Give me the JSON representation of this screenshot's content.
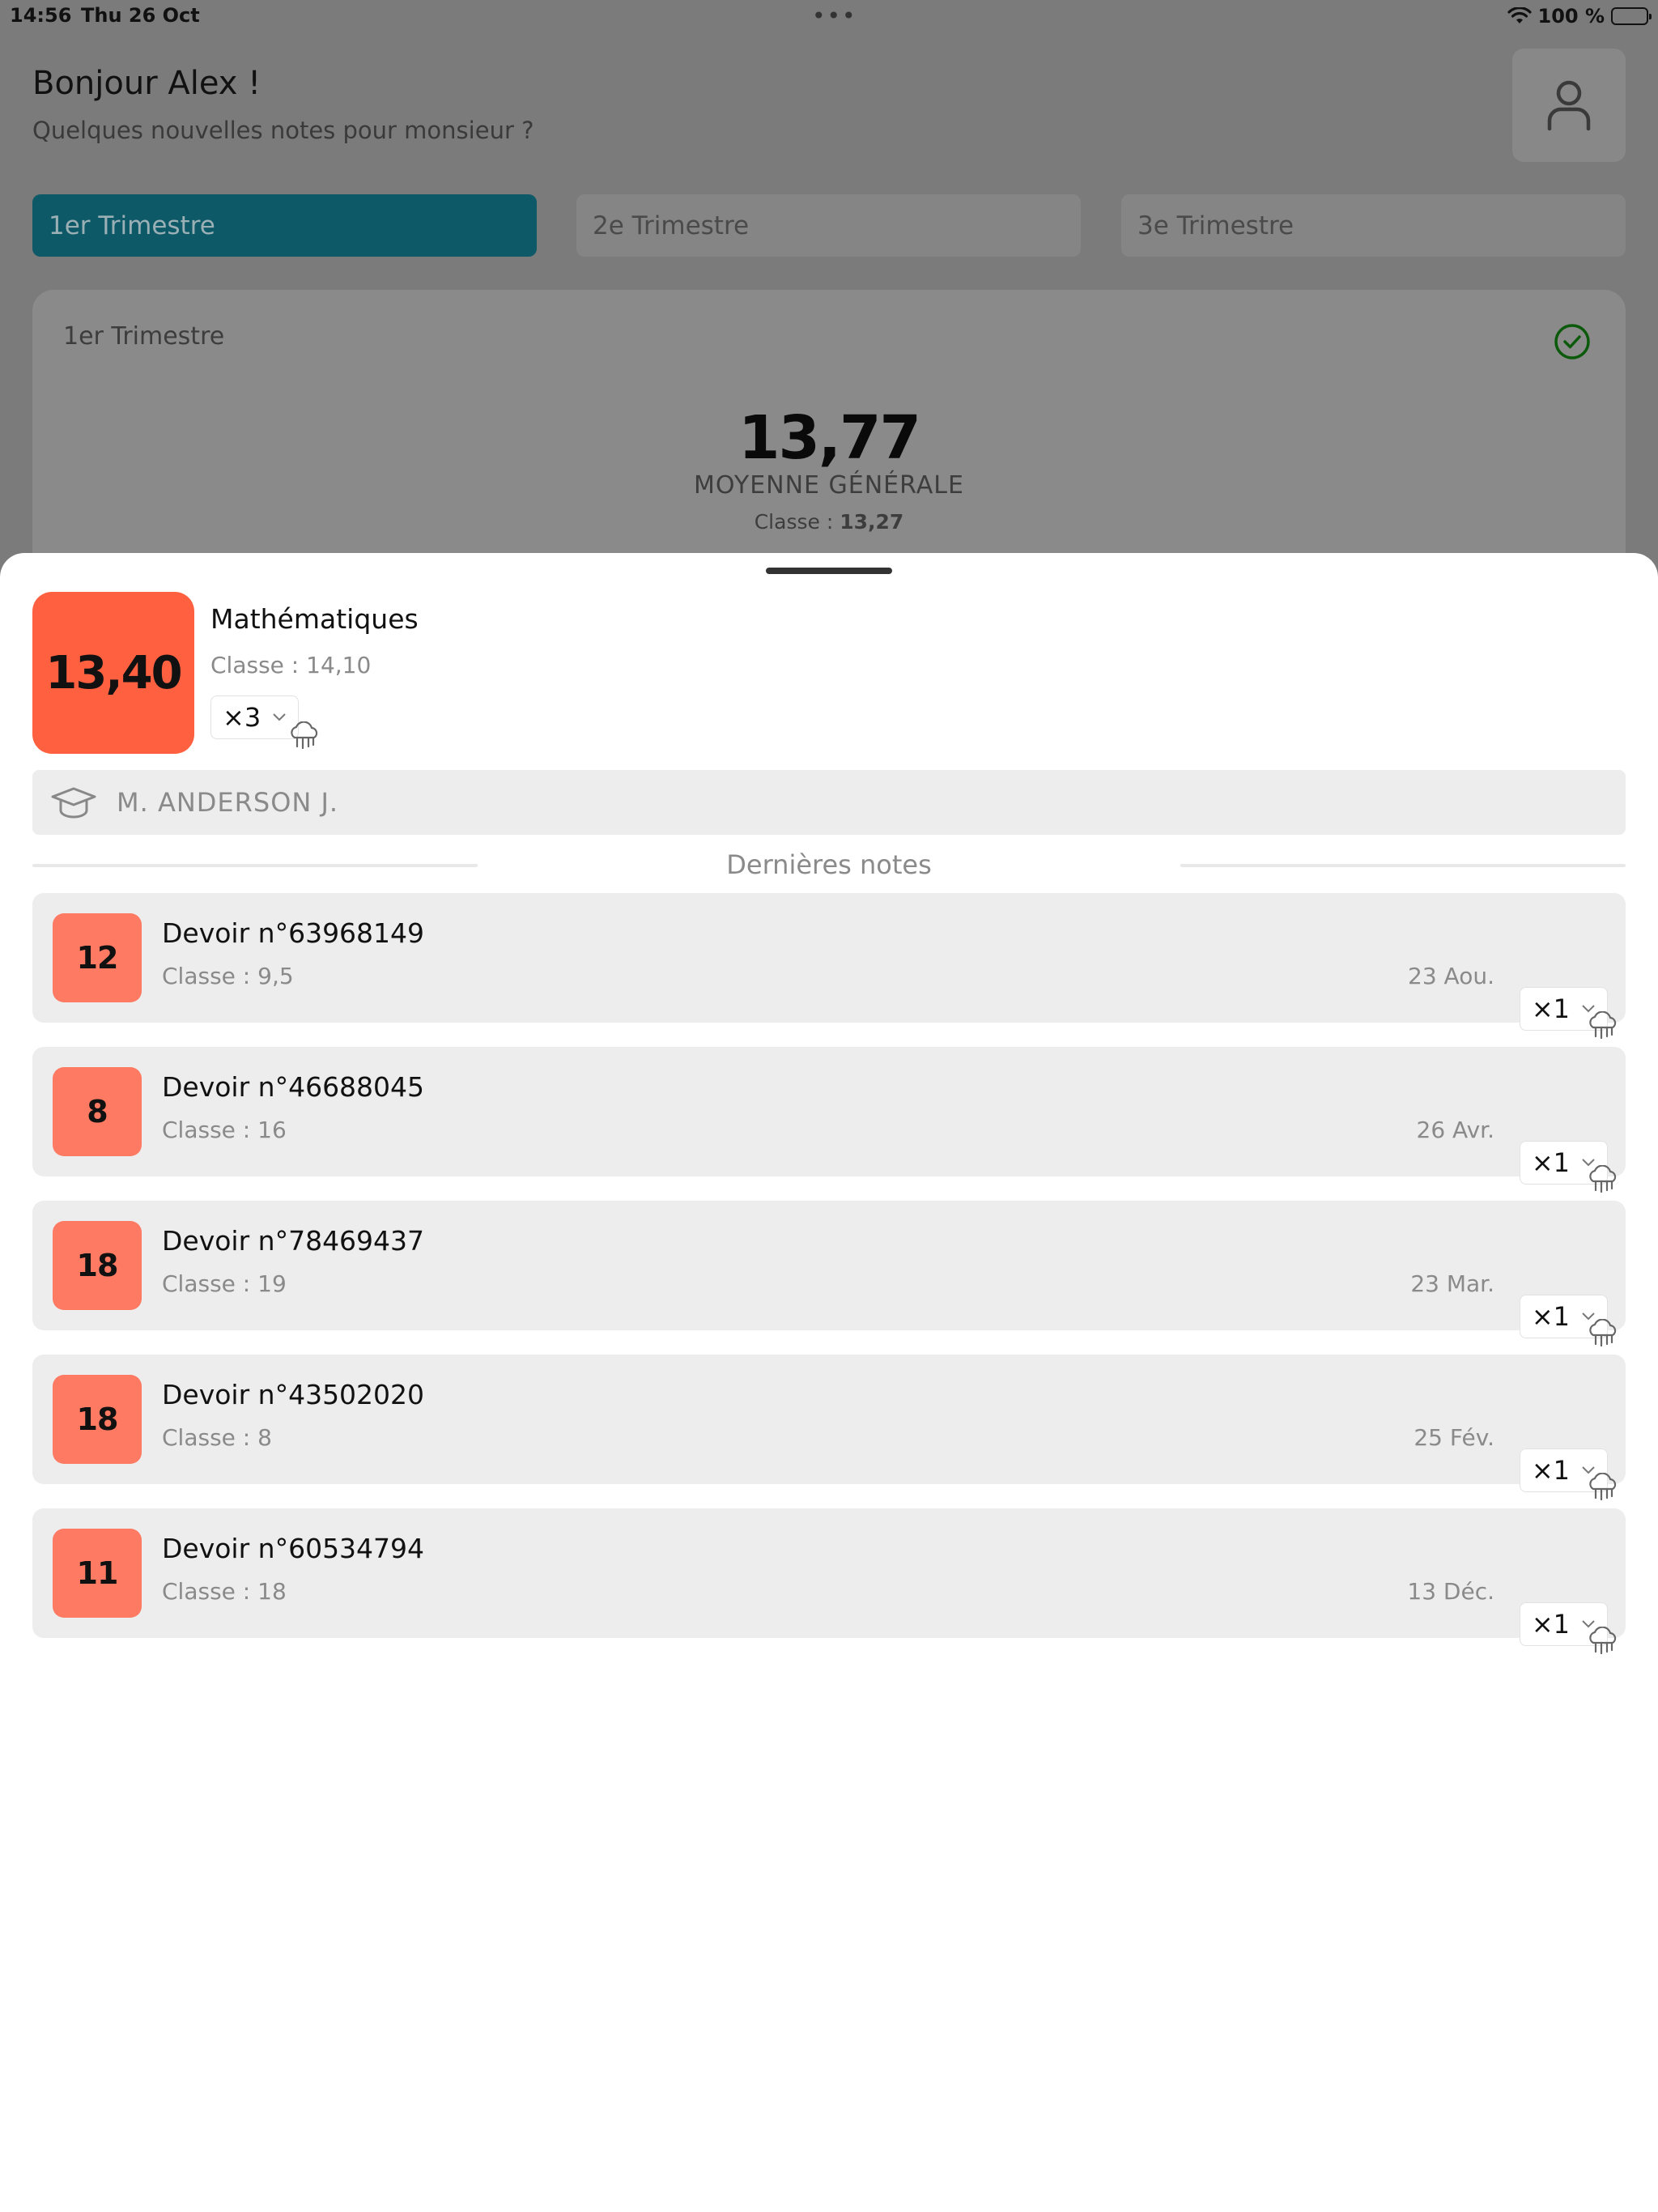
{
  "status_bar": {
    "time": "14:56",
    "date": "Thu 26 Oct",
    "battery": "100 %"
  },
  "header": {
    "greeting": "Bonjour Alex !",
    "subtitle": "Quelques nouvelles notes pour monsieur ?"
  },
  "tabs": [
    {
      "label": "1er Trimestre",
      "active": true
    },
    {
      "label": "2e Trimestre",
      "active": false
    },
    {
      "label": "3e Trimestre",
      "active": false
    }
  ],
  "average_card": {
    "title": "1er Trimestre",
    "value": "13,77",
    "label": "MOYENNE GÉNÉRALE",
    "class_label": "Classe :",
    "class_value": "13,27"
  },
  "subject": {
    "average": "13,40",
    "name": "Mathématiques",
    "class_average": "Classe : 14,10",
    "coefficient": "×3",
    "teacher": "M. ANDERSON J."
  },
  "section": {
    "title": "Dernières notes"
  },
  "grades": [
    {
      "value": "12",
      "title": "Devoir n°63968149",
      "class_average": "Classe : 9,5",
      "date": "23 Aou.",
      "coefficient": "×1"
    },
    {
      "value": "8",
      "title": "Devoir n°46688045",
      "class_average": "Classe : 16",
      "date": "26 Avr.",
      "coefficient": "×1"
    },
    {
      "value": "18",
      "title": "Devoir n°78469437",
      "class_average": "Classe : 19",
      "date": "23 Mar.",
      "coefficient": "×1"
    },
    {
      "value": "18",
      "title": "Devoir n°43502020",
      "class_average": "Classe : 8",
      "date": "25 Fév.",
      "coefficient": "×1"
    },
    {
      "value": "11",
      "title": "Devoir n°60534794",
      "class_average": "Classe : 18",
      "date": "13 Déc.",
      "coefficient": "×1"
    }
  ],
  "colors": {
    "active_tab": "#0e5968",
    "subject_badge": "#ff6040",
    "grade_badge": "#ff7a62",
    "check": "#0b5a0b"
  },
  "icons": [
    "wifi-icon",
    "battery-icon",
    "user-icon",
    "check-circle-icon",
    "chevron-down-icon",
    "cloud-rain-icon",
    "graduation-cap-icon"
  ]
}
